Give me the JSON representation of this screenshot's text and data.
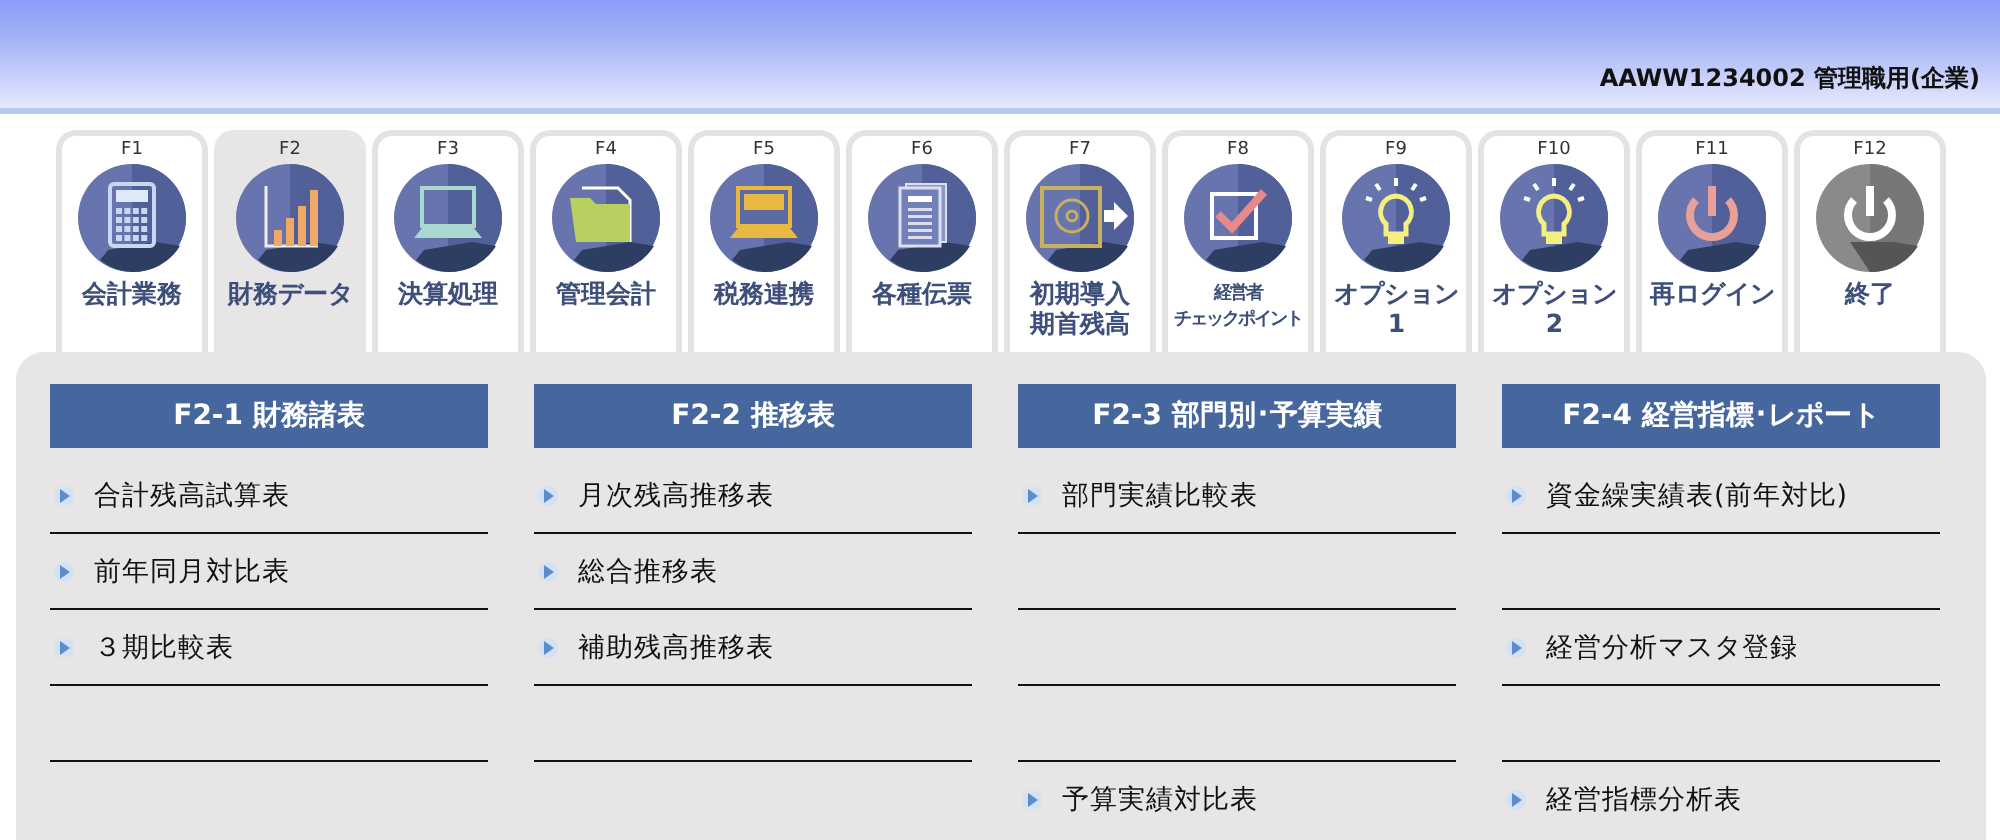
{
  "header": {
    "user": "AAWW1234002 管理職用(企業)"
  },
  "tabs": [
    {
      "key": "F1",
      "lines": [
        "会計業務"
      ],
      "selected": false
    },
    {
      "key": "F2",
      "lines": [
        "財務データ"
      ],
      "selected": true
    },
    {
      "key": "F3",
      "lines": [
        "決算処理"
      ],
      "selected": false
    },
    {
      "key": "F4",
      "lines": [
        "管理会計"
      ],
      "selected": false
    },
    {
      "key": "F5",
      "lines": [
        "税務連携"
      ],
      "selected": false
    },
    {
      "key": "F6",
      "lines": [
        "各種伝票"
      ],
      "selected": false
    },
    {
      "key": "F7",
      "lines": [
        "初期導入",
        "期首残高"
      ],
      "selected": false
    },
    {
      "key": "F8",
      "lines": [
        "経営者",
        "チェックポイント"
      ],
      "selected": false
    },
    {
      "key": "F9",
      "lines": [
        "オプション",
        "1"
      ],
      "selected": false
    },
    {
      "key": "F10",
      "lines": [
        "オプション",
        "2"
      ],
      "selected": false
    },
    {
      "key": "F11",
      "lines": [
        "再ログイン"
      ],
      "selected": false
    },
    {
      "key": "F12",
      "lines": [
        "終了"
      ],
      "selected": false
    }
  ],
  "sections": [
    {
      "title": "F2-1 財務諸表",
      "slots": [
        {
          "kind": "link",
          "label": "合計残高試算表"
        },
        {
          "kind": "link",
          "label": "前年同月対比表"
        },
        {
          "kind": "link",
          "label": "３期比較表"
        },
        {
          "kind": "blank"
        }
      ]
    },
    {
      "title": "F2-2 推移表",
      "slots": [
        {
          "kind": "link",
          "label": "月次残高推移表"
        },
        {
          "kind": "link",
          "label": "総合推移表"
        },
        {
          "kind": "link",
          "label": "補助残高推移表"
        },
        {
          "kind": "blank"
        }
      ]
    },
    {
      "title": "F2-3 部門別･予算実績",
      "slots": [
        {
          "kind": "link",
          "label": "部門実績比較表"
        },
        {
          "kind": "blank"
        },
        {
          "kind": "blank"
        },
        {
          "kind": "blank"
        },
        {
          "kind": "link",
          "label": "予算実績対比表"
        }
      ]
    },
    {
      "title": "F2-4 経営指標･レポート",
      "slots": [
        {
          "kind": "link",
          "label": "資金繰実績表(前年対比)"
        },
        {
          "kind": "blank"
        },
        {
          "kind": "link",
          "label": "経営分析マスタ登録"
        },
        {
          "kind": "blank"
        },
        {
          "kind": "link",
          "label": "経営指標分析表"
        }
      ]
    }
  ]
}
